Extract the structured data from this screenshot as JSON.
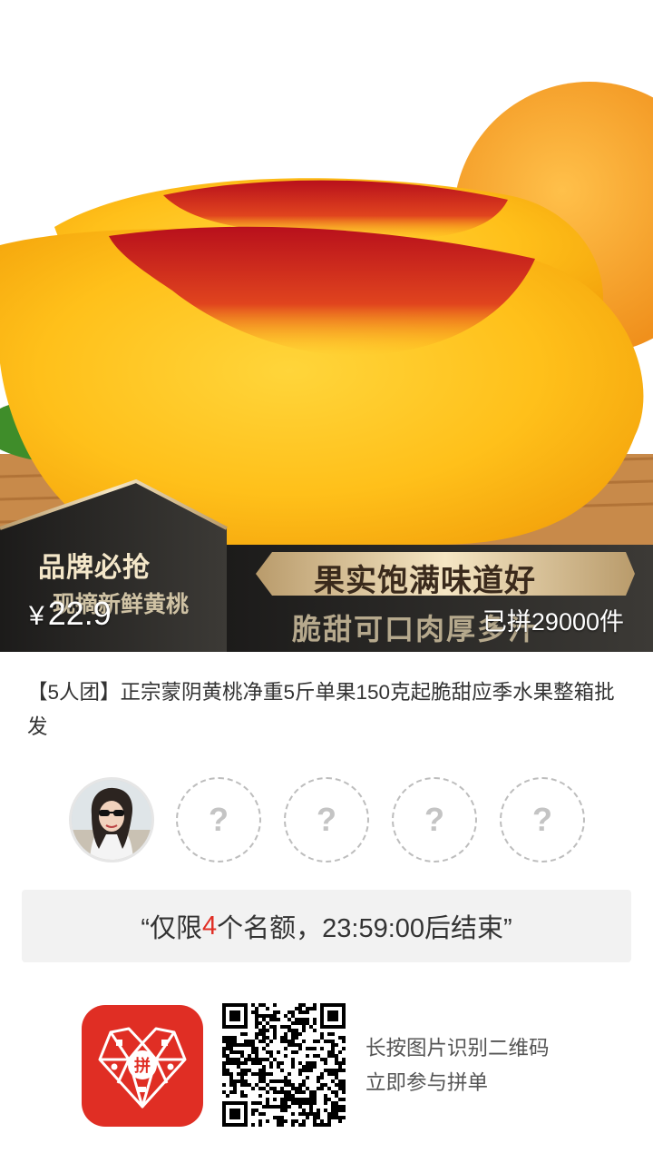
{
  "product": {
    "badge_line1": "品牌必抢",
    "badge_line2": "现摘新鲜黄桃",
    "banner_line1": "果实饱满味道好",
    "banner_line2": "脆甜可口肉厚多汁",
    "currency": "¥",
    "price": "22.9",
    "sold": "已拼29000件",
    "title": "【5人团】正宗蒙阴黄桃净重5斤单果150克起脆甜应季水果整箱批发"
  },
  "group": {
    "empty_slot_icon": "?",
    "deadline_prefix": "“仅限",
    "deadline_count": "4",
    "deadline_suffix": "个名额，23:59:00后结束”"
  },
  "footer": {
    "hint_line1": "长按图片识别二维码",
    "hint_line2": "立即参与拼单"
  },
  "colors": {
    "brand_red": "#e02e24",
    "deadline_bg": "#f2f2f2"
  }
}
